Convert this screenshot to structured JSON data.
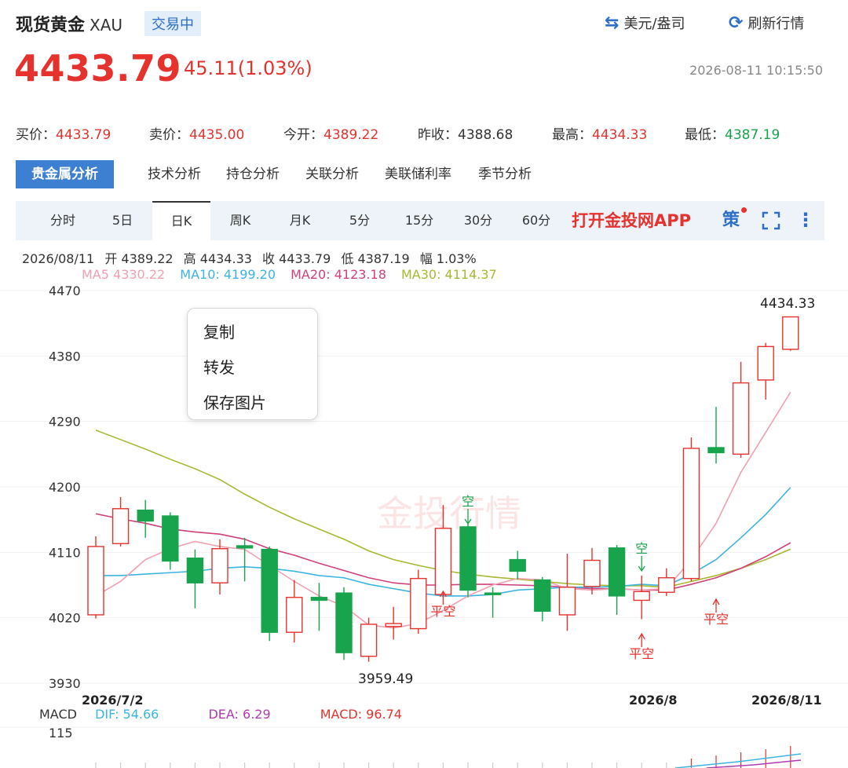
{
  "header": {
    "title": "现货黄金",
    "symbol": "XAU",
    "status": "交易中",
    "currency_toggle": "美元/盎司",
    "refresh": "刷新行情",
    "price": "4433.79",
    "change": "45.11(1.03%)",
    "timestamp": "2026-08-11 10:15:50"
  },
  "quote": {
    "bid_label": "买价：",
    "bid": "4433.79",
    "ask_label": "卖价：",
    "ask": "4435.00",
    "open_label": "今开：",
    "open": "4389.22",
    "prev_close_label": "昨收：",
    "prev_close": "4388.68",
    "high_label": "最高：",
    "high": "4434.33",
    "low_label": "最低：",
    "low": "4387.19"
  },
  "analysis_tabs": [
    "贵金属分析",
    "技术分析",
    "持仓分析",
    "关联分析",
    "美联储利率",
    "季节分析"
  ],
  "period_tabs": [
    "分时",
    "5日",
    "日K",
    "周K",
    "月K",
    "5分",
    "15分",
    "30分",
    "60分"
  ],
  "promo": "打开金投网APP",
  "strategy_label": "策",
  "more_label": "⋮",
  "ohlc": {
    "date": "2026/08/11",
    "open": "开 4389.22",
    "high": "高 4434.33",
    "close": "收 4433.79",
    "low": "低 4387.19",
    "amplitude": "幅 1.03%"
  },
  "ma": {
    "ma5": "MA5  4330.22",
    "ma10": "MA10: 4199.20",
    "ma20": "MA20: 4123.18",
    "ma30": "MA30: 4114.37"
  },
  "colors": {
    "up": "#e5322d",
    "down": "#18a44c",
    "ma5": "#f0a0b0",
    "ma10": "#3cb4e0",
    "ma20": "#d0407a",
    "ma30": "#a8b830",
    "accent": "#3d7fd0"
  },
  "context_menu": [
    "复制",
    "转发",
    "保存图片"
  ],
  "watermark": "金投行情",
  "chart_data": {
    "type": "candlestick",
    "y_ticks": [
      "4470",
      "4380",
      "4290",
      "4200",
      "4110",
      "4020",
      "3930"
    ],
    "ylim": [
      3930,
      4470
    ],
    "x_labels": [
      "2026/7/2",
      "2026/8",
      "2026/8/11"
    ],
    "annotations": {
      "max_label": "4434.33",
      "min_label": "3959.49",
      "signals": [
        "空",
        "平空",
        "平空",
        "空",
        "平空"
      ]
    },
    "candles": [
      {
        "o": 4024,
        "c": 4118,
        "h": 4132,
        "l": 4019
      },
      {
        "o": 4122,
        "c": 4170,
        "h": 4186,
        "l": 4118
      },
      {
        "o": 4168,
        "c": 4153,
        "h": 4182,
        "l": 4130
      },
      {
        "o": 4160,
        "c": 4098,
        "h": 4165,
        "l": 4086
      },
      {
        "o": 4102,
        "c": 4068,
        "h": 4114,
        "l": 4033
      },
      {
        "o": 4068,
        "c": 4115,
        "h": 4128,
        "l": 4052
      },
      {
        "o": 4119,
        "c": 4116,
        "h": 4130,
        "l": 4070
      },
      {
        "o": 4114,
        "c": 4000,
        "h": 4118,
        "l": 3988
      },
      {
        "o": 4000,
        "c": 4048,
        "h": 4072,
        "l": 3986
      },
      {
        "o": 4048,
        "c": 4044,
        "h": 4068,
        "l": 4002
      },
      {
        "o": 4054,
        "c": 3972,
        "h": 4062,
        "l": 3962
      },
      {
        "o": 3967,
        "c": 4011,
        "h": 4020,
        "l": 3959.49
      },
      {
        "o": 4008,
        "c": 4012,
        "h": 4035,
        "l": 3990
      },
      {
        "o": 4005,
        "c": 4074,
        "h": 4086,
        "l": 3998
      },
      {
        "o": 4052,
        "c": 4143,
        "h": 4175,
        "l": 4048
      },
      {
        "o": 4145,
        "c": 4058,
        "h": 4150,
        "l": 4048
      },
      {
        "o": 4054,
        "c": 4052,
        "h": 4062,
        "l": 4020
      },
      {
        "o": 4100,
        "c": 4084,
        "h": 4112,
        "l": 4073
      },
      {
        "o": 4072,
        "c": 4029,
        "h": 4076,
        "l": 4015
      },
      {
        "o": 4024,
        "c": 4062,
        "h": 4108,
        "l": 4002
      },
      {
        "o": 4063,
        "c": 4099,
        "h": 4116,
        "l": 4052
      },
      {
        "o": 4116,
        "c": 4050,
        "h": 4120,
        "l": 4024
      },
      {
        "o": 4044,
        "c": 4056,
        "h": 4078,
        "l": 4018
      },
      {
        "o": 4055,
        "c": 4075,
        "h": 4088,
        "l": 4050
      },
      {
        "o": 4074,
        "c": 4253,
        "h": 4268,
        "l": 4070
      },
      {
        "o": 4254,
        "c": 4247,
        "h": 4310,
        "l": 4232
      },
      {
        "o": 4245,
        "c": 4343,
        "h": 4372,
        "l": 4240
      },
      {
        "o": 4347,
        "c": 4393,
        "h": 4398,
        "l": 4320
      },
      {
        "o": 4389.22,
        "c": 4433.79,
        "h": 4434.33,
        "l": 4387.19
      }
    ],
    "ma5": [
      4050,
      4070,
      4100,
      4115,
      4125,
      4118,
      4114,
      4092,
      4070,
      4050,
      4036,
      4010,
      4006,
      4012,
      4030,
      4050,
      4065,
      4074,
      4072,
      4060,
      4058,
      4060,
      4058,
      4060,
      4100,
      4150,
      4220,
      4275,
      4330.22
    ],
    "ma10": [
      4078,
      4078,
      4080,
      4082,
      4084,
      4088,
      4090,
      4088,
      4084,
      4078,
      4075,
      4066,
      4060,
      4054,
      4050,
      4050,
      4052,
      4058,
      4060,
      4062,
      4062,
      4063,
      4066,
      4064,
      4080,
      4100,
      4130,
      4162,
      4199.2
    ],
    "ma20": [
      4163,
      4156,
      4150,
      4142,
      4138,
      4135,
      4128,
      4115,
      4106,
      4095,
      4085,
      4075,
      4068,
      4065,
      4065,
      4066,
      4066,
      4065,
      4064,
      4062,
      4060,
      4060,
      4058,
      4058,
      4066,
      4075,
      4088,
      4104,
      4123.18
    ],
    "ma30": [
      4278,
      4265,
      4252,
      4238,
      4225,
      4210,
      4190,
      4172,
      4156,
      4142,
      4128,
      4112,
      4100,
      4092,
      4085,
      4080,
      4076,
      4073,
      4070,
      4067,
      4065,
      4064,
      4064,
      4062,
      4070,
      4078,
      4088,
      4100,
      4114.37
    ],
    "macd": {
      "label": "MACD",
      "dif": "DIF: 54.66",
      "dea": "DEA: 6.29",
      "macd": "MACD: 96.74",
      "top_tick": "115"
    }
  }
}
